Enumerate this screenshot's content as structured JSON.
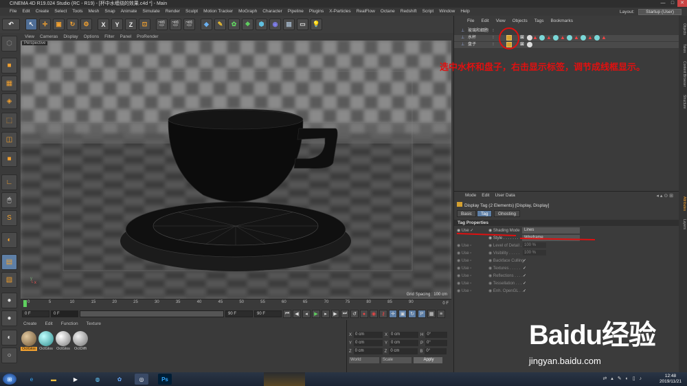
{
  "window": {
    "title": "CINEMA 4D R19.024 Studio (RC - R19) - [杯中水缠绕的效果.c4d *] - Main",
    "controls": [
      "—",
      "□",
      "✕"
    ]
  },
  "menu": [
    "File",
    "Edit",
    "Create",
    "Select",
    "Tools",
    "Mesh",
    "Snap",
    "Animate",
    "Simulate",
    "Render",
    "Sculpt",
    "Motion Tracker",
    "MoGraph",
    "Character",
    "Pipeline",
    "Plugins",
    "X-Particles",
    "RealFlow",
    "Octane",
    "Redshift",
    "Script",
    "Window",
    "Help"
  ],
  "layout": {
    "label": "Layout:",
    "value": "Startup (User)"
  },
  "toolbar": {
    "buttons": [
      "↶",
      "↖",
      "✛",
      "▣",
      "↻",
      "⚙",
      "X",
      "Y",
      "Z",
      "⊡",
      "🎬",
      "🎬",
      "🎬",
      "◆",
      "✎",
      "✿",
      "❖",
      "⬢",
      "◉",
      "▦",
      "▭",
      "💡"
    ]
  },
  "viewport": {
    "menu": [
      "View",
      "Cameras",
      "Display",
      "Options",
      "Filter",
      "Panel",
      "ProRender"
    ],
    "label": "Perspective",
    "grid_spacing": "Grid Spacing : 100 cm"
  },
  "timeline": {
    "ticks": [
      "0",
      "5",
      "10",
      "15",
      "20",
      "25",
      "30",
      "35",
      "40",
      "45",
      "50",
      "55",
      "60",
      "65",
      "70",
      "75",
      "80",
      "85",
      "90"
    ],
    "end_label": "0 F",
    "start_field": "0 F",
    "current_field": "0 F",
    "end_field1": "90 F",
    "end_field2": "90 F"
  },
  "materials": {
    "menu": [
      "Create",
      "Edit",
      "Function",
      "Texture"
    ],
    "items": [
      {
        "label": "OctGlos",
        "color": "#b09070",
        "selected": true
      },
      {
        "label": "OctGlos",
        "color": "#7ad8d8",
        "selected": false
      },
      {
        "label": "OctGlos",
        "color": "#d8d8d8",
        "selected": false
      },
      {
        "label": "OctDiffi",
        "color": "#c8c8c8",
        "selected": false
      }
    ]
  },
  "coordinates": {
    "rows": [
      {
        "a": "X",
        "av": "0 cm",
        "b": "X",
        "bv": "0 cm",
        "c": "H",
        "cv": "0°"
      },
      {
        "a": "Y",
        "av": "0 cm",
        "b": "Y",
        "bv": "0 cm",
        "c": "P",
        "cv": "0°"
      },
      {
        "a": "Z",
        "av": "0 cm",
        "b": "Z",
        "bv": "0 cm",
        "c": "B",
        "cv": "0°"
      }
    ],
    "mode1": "World",
    "mode2": "Scale",
    "apply": "Apply"
  },
  "objects": {
    "menu": [
      "File",
      "Edit",
      "View",
      "Objects",
      "Tags",
      "Bookmarks"
    ],
    "rows": [
      {
        "name": "玻璃和细胞",
        "selected": false
      },
      {
        "name": "水杯",
        "selected": true
      },
      {
        "name": "盘子",
        "selected": true
      }
    ],
    "annotation": "选中水杯和盘子，右击显示标签，调节成线框显示。"
  },
  "attributes": {
    "menu": [
      "Mode",
      "Edit",
      "User Data"
    ],
    "header": "Display Tag (2 Elements) [Display, Display]",
    "tabs": [
      "Basic",
      "Tag",
      "Ghosting"
    ],
    "section": "Tag Properties",
    "rows": [
      {
        "use": "Use",
        "label": "Shading Mode",
        "value": "Lines",
        "kind": "select"
      },
      {
        "use": "",
        "label": "Style . . . . . . .",
        "value": "Wireframe",
        "kind": "select"
      },
      {
        "use": "Use",
        "label": "Level of Detail . .",
        "value": "100 %",
        "kind": "num"
      },
      {
        "use": "Use",
        "label": "Visibility . . . . .",
        "value": "100 %",
        "kind": "num"
      },
      {
        "use": "Use",
        "label": "Backface Culling",
        "value": "✓",
        "kind": "chk"
      },
      {
        "use": "Use",
        "label": "Textures . . . . .",
        "value": "✓",
        "kind": "chk"
      },
      {
        "use": "Use",
        "label": "Reflections . . . .",
        "value": "✓",
        "kind": "chk"
      },
      {
        "use": "Use",
        "label": "Tessellation . . .",
        "value": "✓",
        "kind": "chk"
      },
      {
        "use": "Use",
        "label": "Enh. OpenGL . . .",
        "value": "✓",
        "kind": "chk"
      }
    ]
  },
  "right_tabs": [
    "Objects",
    "Takes",
    "Content Browser",
    "Structure",
    "Attributes",
    "Layers"
  ],
  "taskbar": {
    "time": "12:48",
    "date": "2019/11/21"
  },
  "watermark": {
    "logo": "Baidu经验",
    "url": "jingyan.baidu.com"
  }
}
